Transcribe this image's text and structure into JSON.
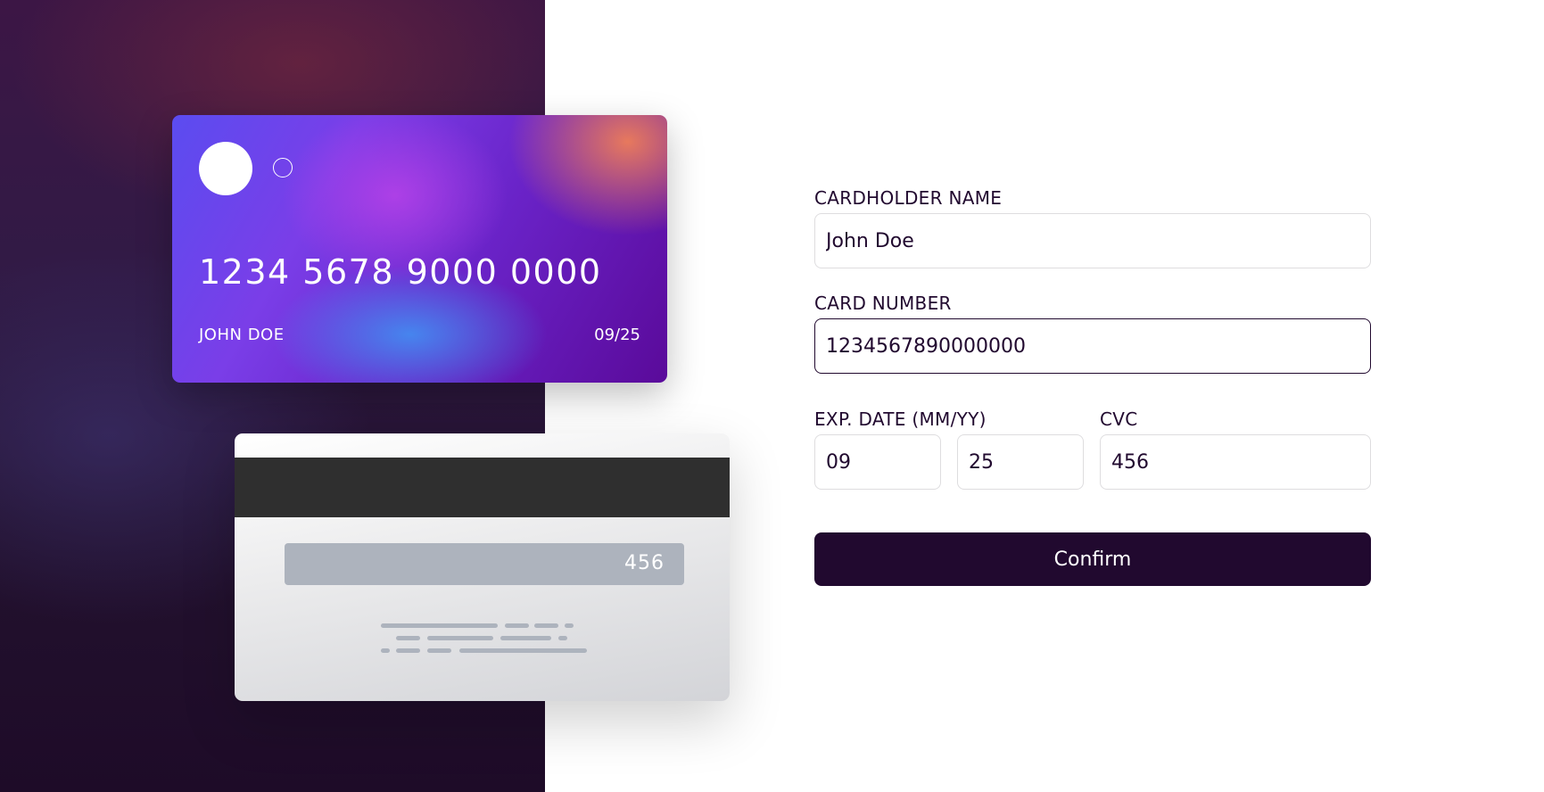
{
  "card_front": {
    "number": "1234 5678 9000 0000",
    "name": "JOHN DOE",
    "expiry": "09/25"
  },
  "card_back": {
    "cvc": "456"
  },
  "form": {
    "cardholder_label": "CARDHOLDER NAME",
    "cardholder_value": "John Doe",
    "card_number_label": "CARD NUMBER",
    "card_number_value": "1234567890000000",
    "exp_label": "EXP. DATE (MM/YY)",
    "exp_month_value": "09",
    "exp_year_value": "25",
    "cvc_label": "CVC",
    "cvc_value": "456",
    "confirm_label": "Confirm"
  },
  "colors": {
    "dark_violet": "#21092f",
    "input_border": "#dedddf"
  }
}
